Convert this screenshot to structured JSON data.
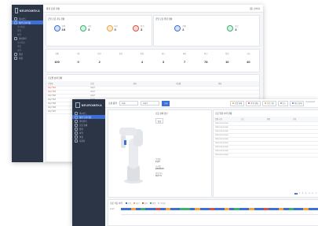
{
  "brand": "NEUROMEKA",
  "colors": {
    "sidebar": "#2c3545",
    "accent": "#3d6fd6",
    "orange": "#f4a23a",
    "green": "#3cb371",
    "red": "#e0523f"
  },
  "back": {
    "nav": [
      "대시보드",
      "생산 모니터링",
      "설비관리",
      "알람",
      "설정"
    ],
    "sub_items": [
      "모니터링",
      "작업",
      "이력"
    ],
    "section_title": "통합 로봇 현황",
    "user": "관리자",
    "summary1_title": "금일 로봇 가동 현황",
    "summary2_title": "금일 로봇 알람 현황",
    "kpis1": [
      {
        "label": "전체",
        "value": "18"
      },
      {
        "label": "가동",
        "value": "3"
      },
      {
        "label": "대기",
        "value": "3"
      },
      {
        "label": "정지",
        "value": "3"
      }
    ],
    "kpis2": [
      {
        "label": "전체",
        "value": "2"
      },
      {
        "label": "경고",
        "value": "3"
      }
    ],
    "stats_labels": [
      "전체",
      "가동",
      "대기",
      "정지",
      "알람",
      "경고",
      "에러",
      "통신",
      "점검",
      "기타"
    ],
    "stats_values": [
      "100",
      "0",
      "2",
      "",
      "4",
      "3",
      "7",
      "78",
      "10",
      "40"
    ],
    "table_title": "로봇별 상세 현황",
    "col_headers": [
      "로봇명",
      "모델",
      "상태",
      "가동률",
      "알람"
    ],
    "rows": [
      "Indy7 #01",
      "Indy7 #02",
      "Indy7 #03",
      "Indy7 #04",
      "Indy7 #05",
      "Indy7 #06",
      "Indy7 #07"
    ]
  },
  "front": {
    "nav": [
      "대시보드",
      "생산 모니터링",
      "설비관리",
      "로봇 상세",
      "알람",
      "이력",
      "설정",
      "사용자"
    ],
    "filter_label1": "로봇 종류",
    "filter_val1": "Indy",
    "filter_val2": "Indy7",
    "search_btn": "조회",
    "kpi_chips": [
      "로봇 상태",
      "운행 상태",
      "프로그램",
      "모드",
      "통신 상태"
    ],
    "kpi_value_right": "Connected",
    "robot_panel_title": "로봇 상세 정보",
    "robot_badge": "정상",
    "robot_info": [
      {
        "k": "모델명",
        "v": "Indy7"
      },
      {
        "k": "시리얼",
        "v": "IM000000"
      },
      {
        "k": "관절 온도",
        "v": "36.0 °C"
      }
    ],
    "alarm_panel_title": "로봇 알람 이력 현황",
    "alarm_cols": [
      "발생 시간",
      "코드",
      "내용",
      "조치"
    ],
    "alarm_rows": [
      "2023-01-01 00:00:00",
      "2023-01-01 00:00:00",
      "2023-01-01 00:00:00",
      "2023-01-01 00:00:00",
      "2023-01-01 00:00:00",
      "2023-01-01 00:00:00",
      "2023-01-01 00:00:00",
      "2023-01-01 00:00:00",
      "2023-01-01 00:00:00"
    ],
    "pagination": [
      "1",
      "2",
      "3",
      "4",
      "5",
      "6",
      "7"
    ],
    "timeline_title": "로봇 가동 이력",
    "timeline_legend": [
      "가동",
      "대기",
      "정지",
      "알람",
      "비가동"
    ],
    "timeline_row_label": "Indy7"
  }
}
